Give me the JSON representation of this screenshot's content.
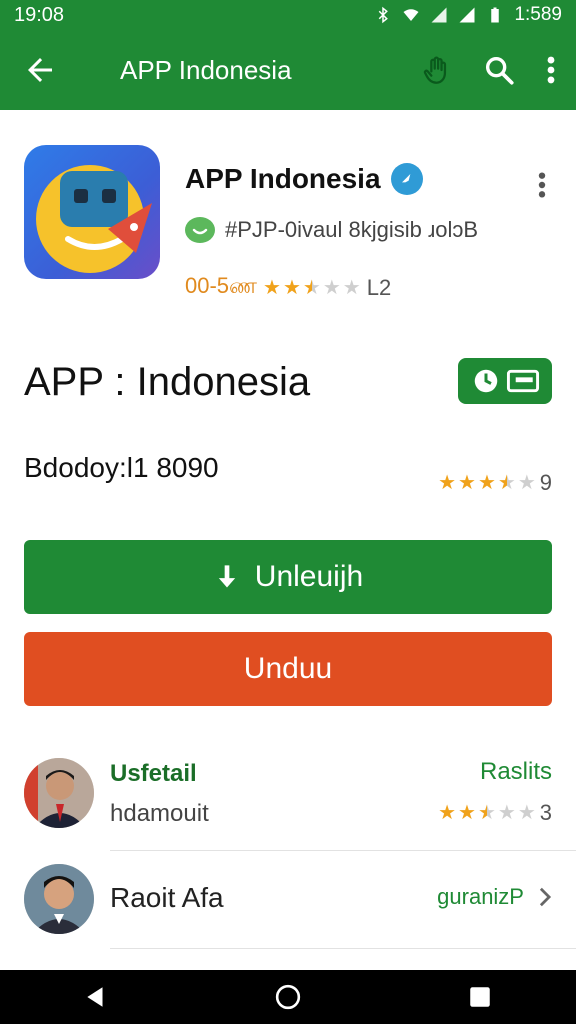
{
  "status_bar": {
    "time": "19:08",
    "clock_right": "1:589",
    "icons": [
      "bluetooth-icon",
      "wifi-icon",
      "signal-icon",
      "signal-icon",
      "battery-icon"
    ]
  },
  "app_bar": {
    "title": "APP Indonesia",
    "actions": [
      "hand-icon",
      "search-icon",
      "more-vert-icon"
    ]
  },
  "header": {
    "app_name": "APP Indonesia",
    "developer": "#PJP-0ivaul 8kjgisib ɹolɔB",
    "rating_text": "00-5ண",
    "rating_stars": 2.5,
    "rating_count": "L2"
  },
  "main": {
    "title": "APP : Indonesia",
    "subtitle": "Bdodoy:l1 8090",
    "right_rating_stars": 3.5,
    "right_rating_value": "9"
  },
  "buttons": {
    "primary_label": "Unleuijh",
    "secondary_label": "Unduu"
  },
  "list": {
    "items": [
      {
        "title": "Usfetail",
        "subtitle": "hdamouit",
        "right_text": "Raslits",
        "stars": 2.5,
        "star_value": "3"
      },
      {
        "title": "Raoit Afa",
        "right_text": "guranizP"
      }
    ]
  },
  "colors": {
    "brand_green": "#1f8a35",
    "accent_orange": "#e04e21",
    "star_gold": "#f0a21b"
  }
}
